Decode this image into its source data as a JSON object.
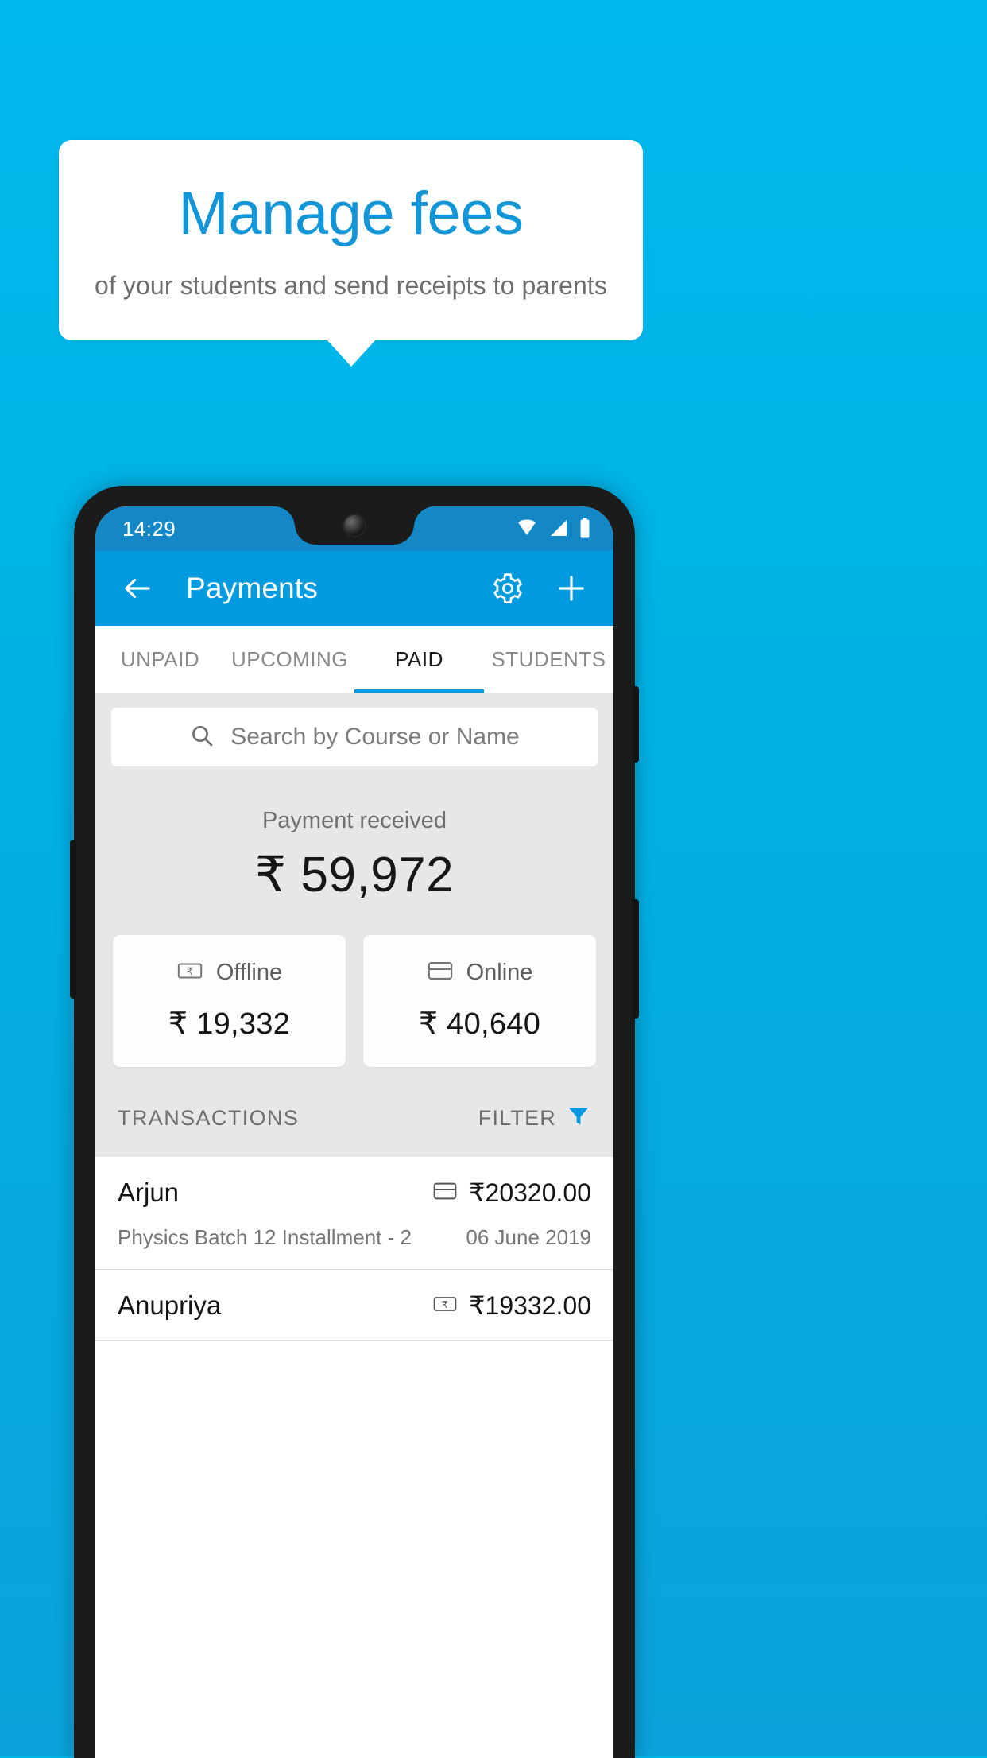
{
  "promo": {
    "headline": "Manage fees",
    "subhead": "of your students and send receipts to parents",
    "background_color": "#00B4E8",
    "headline_color": "#1296D8",
    "card_color": "#FFFFFF"
  },
  "phone": {
    "status_bar": {
      "time": "14:29",
      "icons": [
        "wifi-icon",
        "signal-icon",
        "battery-icon"
      ],
      "background_color": "#1487C6"
    },
    "app_bar": {
      "back_icon": "arrow-left-icon",
      "title": "Payments",
      "settings_icon": "gear-icon",
      "add_icon": "plus-icon",
      "background_color": "#039BE0"
    },
    "tabs": {
      "active_index": 2,
      "accent_color": "#039BE0",
      "items": [
        {
          "label": "UNPAID"
        },
        {
          "label": "UPCOMING"
        },
        {
          "label": "PAID"
        },
        {
          "label": "STUDENTS"
        }
      ]
    },
    "search": {
      "icon": "search-icon",
      "placeholder": "Search by Course or Name",
      "value": ""
    },
    "summary": {
      "label": "Payment received",
      "amount": "₹ 59,972",
      "cards": [
        {
          "icon": "rupee-note-icon",
          "label": "Offline",
          "amount": "₹ 19,332"
        },
        {
          "icon": "credit-card-icon",
          "label": "Online",
          "amount": "₹ 40,640"
        }
      ]
    },
    "transactions_header": {
      "title": "TRANSACTIONS",
      "filter_label": "FILTER",
      "filter_icon": "funnel-icon",
      "filter_icon_color": "#039BE0"
    },
    "transactions": [
      {
        "name": "Arjun",
        "method_icon": "credit-card-icon",
        "amount": "₹20320.00",
        "description": "Physics Batch 12 Installment - 2",
        "date": "06 June 2019"
      },
      {
        "name": "Anupriya",
        "method_icon": "rupee-note-icon",
        "amount": "₹19332.00",
        "description": "",
        "date": ""
      }
    ]
  }
}
